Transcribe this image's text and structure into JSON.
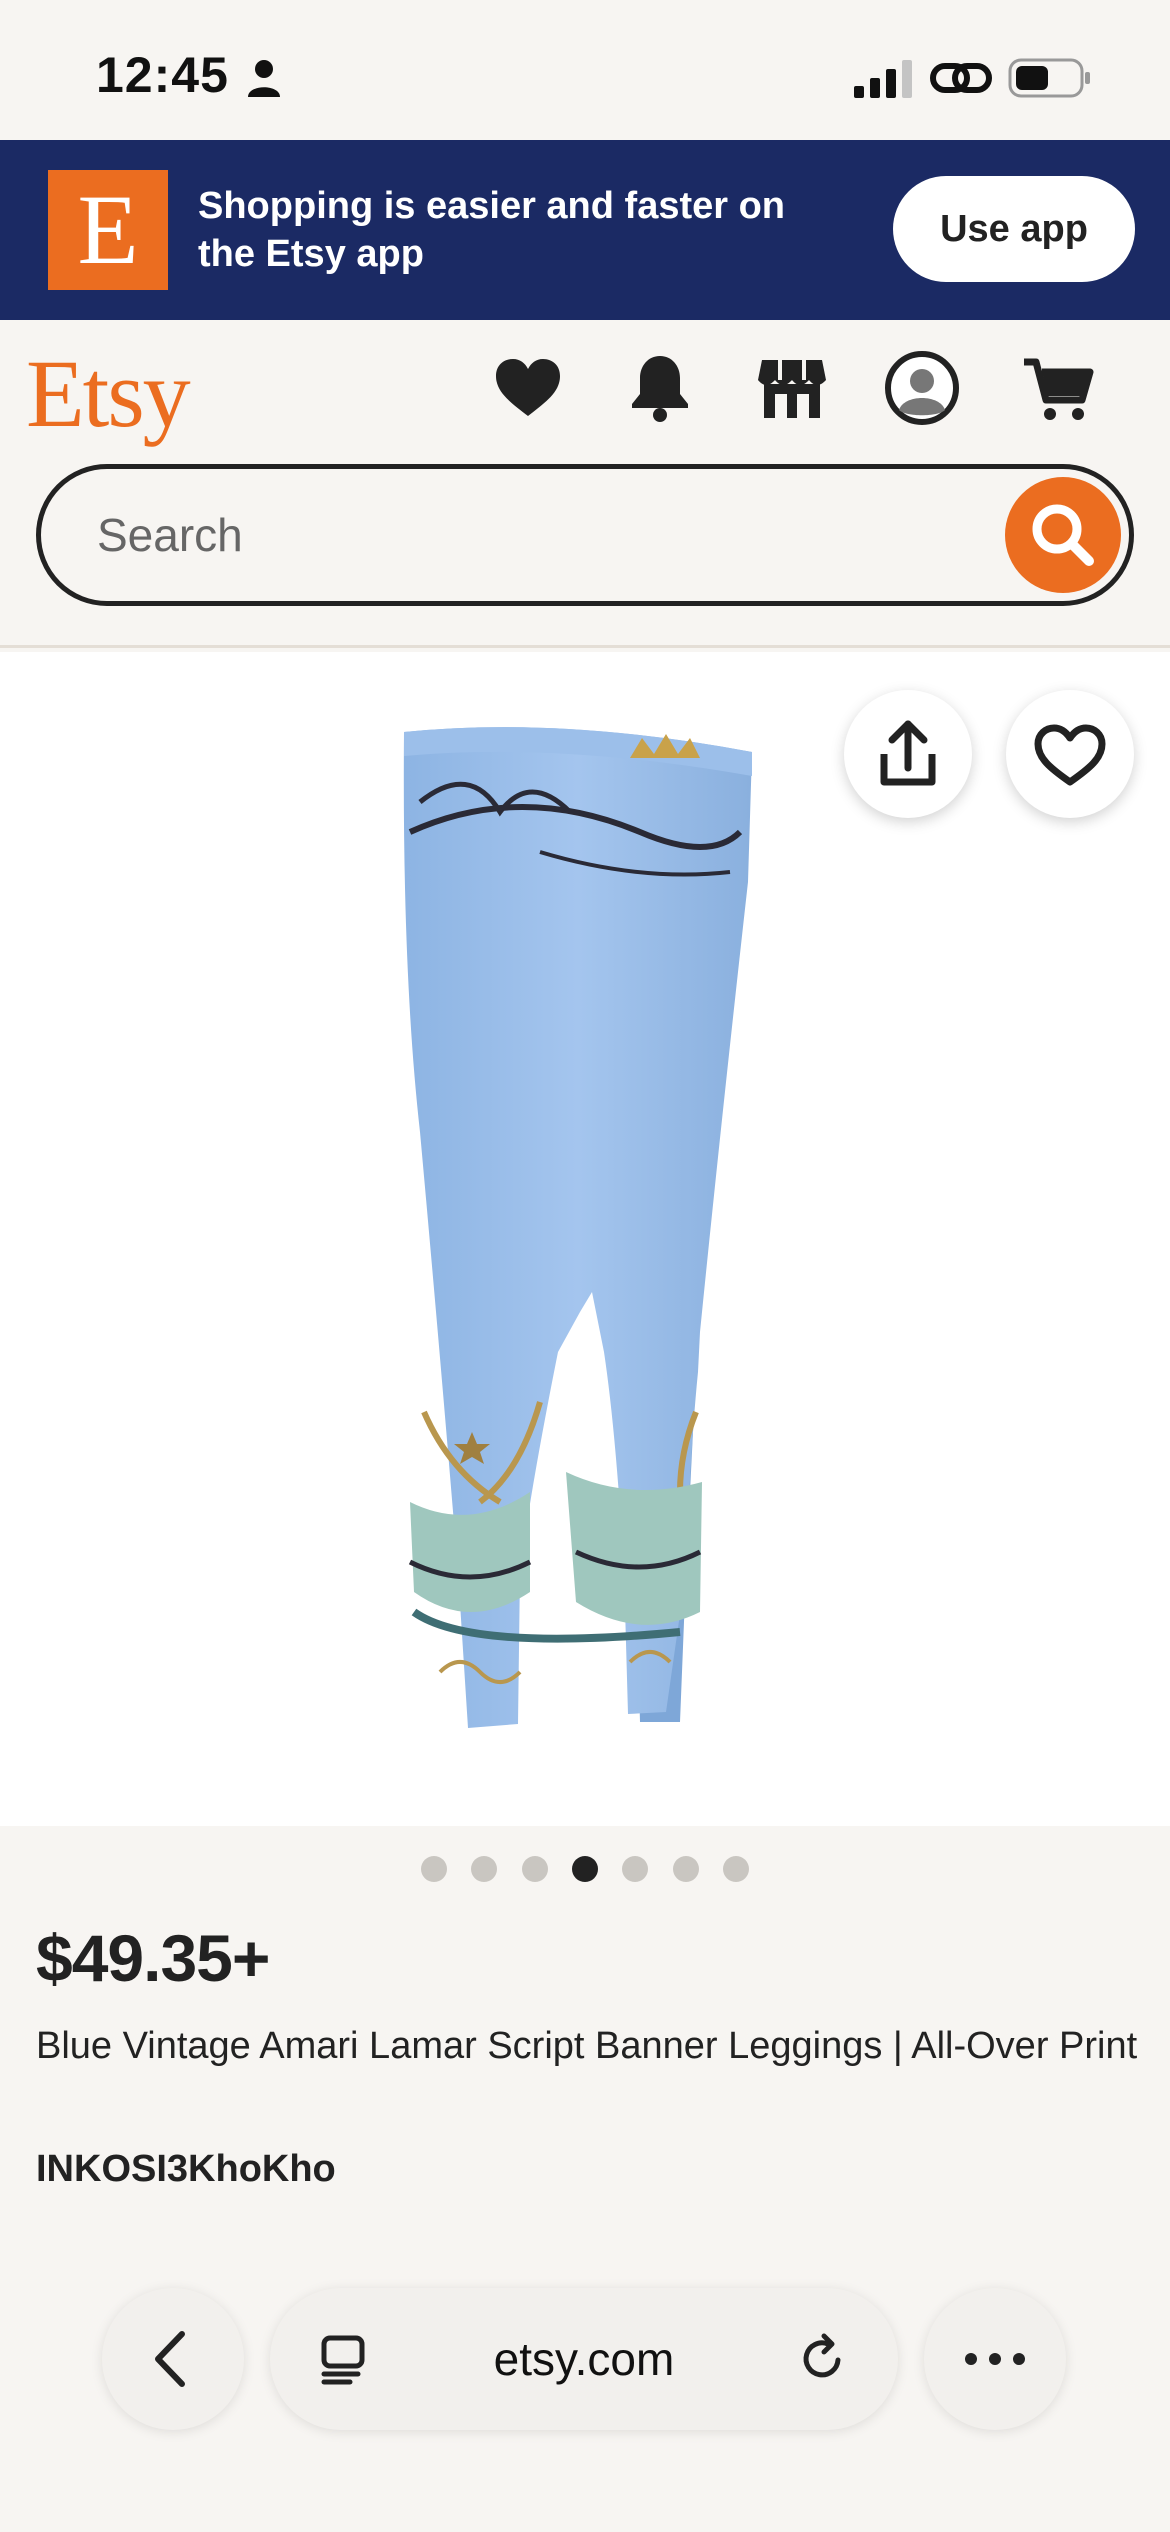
{
  "status_bar": {
    "time": "12:45",
    "icons": [
      "person-icon",
      "signal-icon",
      "link-icon",
      "battery-icon"
    ]
  },
  "app_banner": {
    "logo_letter": "E",
    "text": "Shopping is easier and faster on the Etsy app",
    "button_label": "Use app",
    "colors": {
      "background": "#1B2A64",
      "logo": "#EB6D20"
    }
  },
  "header": {
    "logo": "Etsy",
    "icons": [
      "heart-icon",
      "bell-icon",
      "shop-icon",
      "account-icon",
      "cart-icon"
    ],
    "search": {
      "placeholder": "Search",
      "value": ""
    },
    "colors": {
      "brand": "#EB6D20"
    }
  },
  "product": {
    "image_count": 7,
    "active_image_index": 3,
    "price": "$49.35+",
    "title": "Blue Vintage Amari Lamar Script Banner Leggings | All-Over Print",
    "shop": "INKOSI3KhoKho",
    "image_print_text": [
      "AmariLamar",
      "ri La",
      "Ama"
    ]
  },
  "browser": {
    "url": "etsy.com",
    "icons": [
      "back-icon",
      "tabs-icon",
      "reload-icon",
      "more-icon"
    ]
  }
}
